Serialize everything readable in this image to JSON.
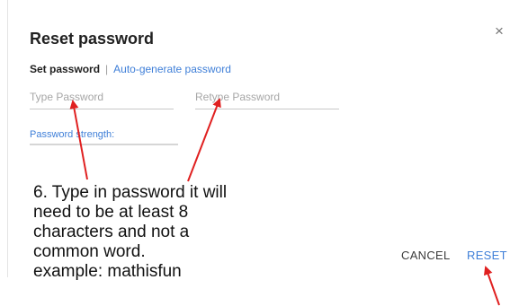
{
  "dialog": {
    "title": "Reset password",
    "close_icon": "×"
  },
  "tabs": {
    "set_password": "Set password",
    "separator": "|",
    "auto_generate": "Auto-generate password"
  },
  "fields": {
    "password_placeholder": "Type Password",
    "password_value": "",
    "retype_placeholder": "Retype Password",
    "retype_value": "",
    "strength_label": "Password strength:"
  },
  "annotation": {
    "lines": [
      "6. Type in password it will",
      "need to be at least 8",
      "characters and not a",
      "common word.",
      "example:  mathisfun"
    ]
  },
  "actions": {
    "cancel": "CANCEL",
    "reset": "RESET"
  },
  "colors": {
    "accent": "#3f7fd8",
    "arrow": "#e02020"
  },
  "icons": [
    "close-icon"
  ]
}
